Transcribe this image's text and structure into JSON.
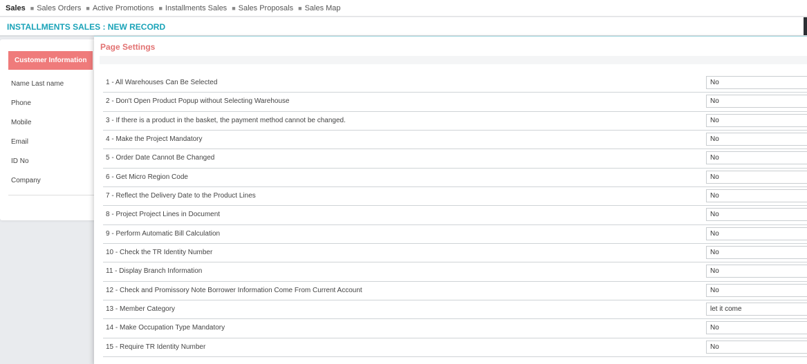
{
  "topnav": {
    "items": [
      "Sales",
      "Sales Orders",
      "Active Promotions",
      "Installments Sales",
      "Sales Proposals",
      "Sales Map"
    ]
  },
  "page": {
    "title": "INSTALLMENTS SALES : NEW RECORD"
  },
  "customer_card": {
    "button_label": "Customer Information",
    "fields": [
      "Name Last name",
      "Phone",
      "Mobile",
      "Email",
      "ID No",
      "Company"
    ]
  },
  "modal": {
    "title": "Page Settings",
    "settings": [
      {
        "label": "1 - All Warehouses Can Be Selected",
        "value": "No"
      },
      {
        "label": "2 - Don't Open Product Popup without Selecting Warehouse",
        "value": "No"
      },
      {
        "label": "3 - If there is a product in the basket, the payment method cannot be changed.",
        "value": "No"
      },
      {
        "label": "4 - Make the Project Mandatory",
        "value": "No"
      },
      {
        "label": "5 - Order Date Cannot Be Changed",
        "value": "No"
      },
      {
        "label": "6 - Get Micro Region Code",
        "value": "No"
      },
      {
        "label": "7 - Reflect the Delivery Date to the Product Lines",
        "value": "No"
      },
      {
        "label": "8 - Project Project Lines in Document",
        "value": "No"
      },
      {
        "label": "9 - Perform Automatic Bill Calculation",
        "value": "No"
      },
      {
        "label": "10 - Check the TR Identity Number",
        "value": "No"
      },
      {
        "label": "11 - Display Branch Information",
        "value": "No"
      },
      {
        "label": "12 - Check and Promissory Note Borrower Information Come From Current Account",
        "value": "No"
      },
      {
        "label": "13 - Member Category",
        "value": "let it come"
      },
      {
        "label": "14 - Make Occupation Type Mandatory",
        "value": "No"
      },
      {
        "label": "15 - Require TR Identity Number",
        "value": "No"
      }
    ]
  }
}
